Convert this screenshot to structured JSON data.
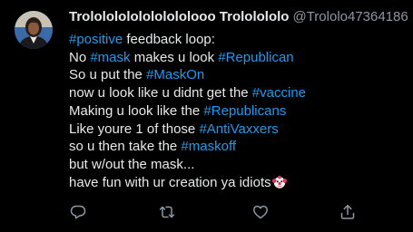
{
  "tweet": {
    "display_name": "Trolololololololololooo Trololololo",
    "handle": "@Trololo47364186",
    "body": {
      "line1": {
        "tag": "#positive",
        "rest": " feedback loop:"
      },
      "line2": {
        "pre": "No ",
        "tag": "#mask",
        "mid": " makes u look ",
        "tag2": "#Republican"
      },
      "line3": {
        "pre": "So u put the ",
        "tag": "#MaskOn"
      },
      "line4": {
        "pre": "now u look like u didnt get the ",
        "tag": "#vaccine"
      },
      "line5": {
        "pre": "Making u look like the ",
        "tag": "#Republicans"
      },
      "line6": {
        "pre": "Like youre 1 of those ",
        "tag": "#AntiVaxxers"
      },
      "line7": {
        "pre": "so u then take the ",
        "tag": "#maskoff"
      },
      "line8": {
        "text": "but w/out the mask..."
      },
      "line9": {
        "text": "have fun with ur creation ya idiots"
      }
    },
    "emoji": "clown-face",
    "colors": {
      "background": "#000000",
      "text": "#e7e9ea",
      "muted": "#8b98a5",
      "hashtag": "#1d9bf0"
    },
    "actions": [
      "reply-icon",
      "retweet-icon",
      "like-icon",
      "share-icon"
    ]
  }
}
